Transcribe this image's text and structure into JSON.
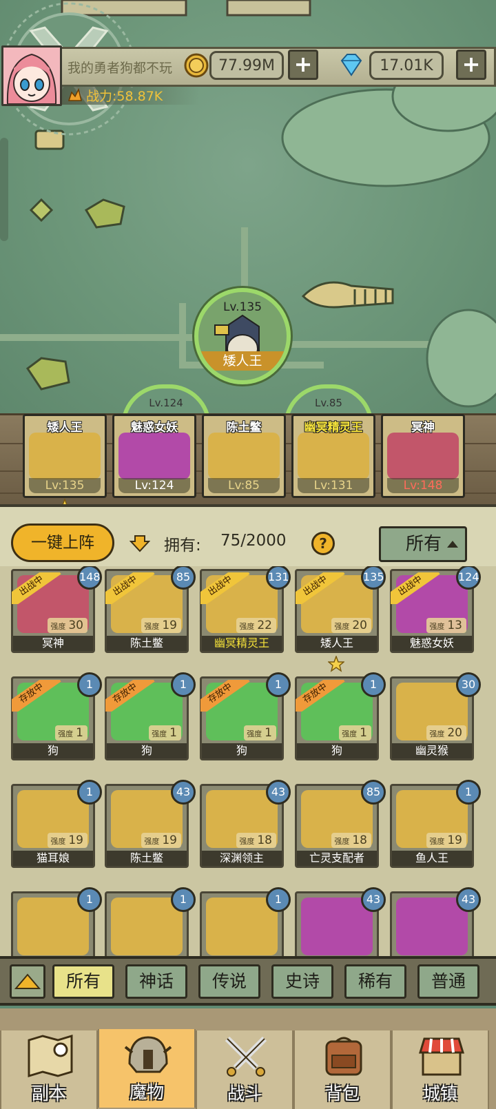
{
  "header": {
    "player_name": "我的勇者狗都不玩",
    "gold": "77.99M",
    "gems": "17.01K",
    "power_label": "战力:58.87K",
    "plus_label": "+"
  },
  "selected": {
    "level": "Lv.135",
    "name": "矮人王"
  },
  "ghost_levels": [
    "Lv.124",
    "Lv.85"
  ],
  "team": [
    {
      "name": "矮人王",
      "level": "Lv:135",
      "color": "#d9b24a"
    },
    {
      "name": "魅惑女妖",
      "level": "Lv:124",
      "color": "#b24aa8"
    },
    {
      "name": "陈土鳖",
      "level": "Lv:85",
      "color": "#d9b24a"
    },
    {
      "name": "幽冥精灵王",
      "level": "Lv:131",
      "color": "#d9b24a"
    },
    {
      "name": "冥神",
      "level": "Lv:148",
      "color": "#c2566a"
    }
  ],
  "inventory": {
    "one_click_label": "一键上阵",
    "own_label": "拥有:",
    "own_count": "75/2000",
    "help": "?",
    "sort_label": "所有",
    "strength_prefix": "强度",
    "ribbons": {
      "battle": "出战中",
      "stored": "存放中"
    },
    "monsters": [
      {
        "name": "冥神",
        "level": "148",
        "strength": "30",
        "bg": "#c2566a",
        "ribbon": "battle"
      },
      {
        "name": "陈土鳖",
        "level": "85",
        "strength": "19",
        "bg": "#d9b24a",
        "ribbon": "battle"
      },
      {
        "name": "幽冥精灵王",
        "level": "131",
        "strength": "22",
        "bg": "#d9b24a",
        "ribbon": "battle"
      },
      {
        "name": "矮人王",
        "level": "135",
        "strength": "20",
        "bg": "#d9b24a",
        "ribbon": "battle"
      },
      {
        "name": "魅惑女妖",
        "level": "124",
        "strength": "13",
        "bg": "#b24aa8",
        "ribbon": "battle"
      },
      {
        "name": "狗",
        "level": "1",
        "strength": "1",
        "bg": "#5fbf5a",
        "ribbon": "stored"
      },
      {
        "name": "狗",
        "level": "1",
        "strength": "1",
        "bg": "#5fbf5a",
        "ribbon": "stored"
      },
      {
        "name": "狗",
        "level": "1",
        "strength": "1",
        "bg": "#5fbf5a",
        "ribbon": "stored"
      },
      {
        "name": "狗",
        "level": "1",
        "strength": "1",
        "bg": "#5fbf5a",
        "ribbon": "stored"
      },
      {
        "name": "幽灵猴",
        "level": "30",
        "strength": "20",
        "bg": "#d9b24a",
        "ribbon": ""
      },
      {
        "name": "猫耳娘",
        "level": "1",
        "strength": "19",
        "bg": "#d9b24a",
        "ribbon": ""
      },
      {
        "name": "陈土鳖",
        "level": "43",
        "strength": "19",
        "bg": "#d9b24a",
        "ribbon": ""
      },
      {
        "name": "深渊领主",
        "level": "43",
        "strength": "18",
        "bg": "#d9b24a",
        "ribbon": ""
      },
      {
        "name": "亡灵支配者",
        "level": "85",
        "strength": "18",
        "bg": "#d9b24a",
        "ribbon": ""
      },
      {
        "name": "鱼人王",
        "level": "1",
        "strength": "19",
        "bg": "#d9b24a",
        "ribbon": ""
      },
      {
        "name": "",
        "level": "1",
        "strength": "",
        "bg": "#d9b24a",
        "ribbon": ""
      },
      {
        "name": "",
        "level": "1",
        "strength": "",
        "bg": "#d9b24a",
        "ribbon": ""
      },
      {
        "name": "",
        "level": "1",
        "strength": "",
        "bg": "#d9b24a",
        "ribbon": ""
      },
      {
        "name": "",
        "level": "43",
        "strength": "",
        "bg": "#b24aa8",
        "ribbon": ""
      },
      {
        "name": "",
        "level": "43",
        "strength": "",
        "bg": "#b24aa8",
        "ribbon": ""
      }
    ]
  },
  "filters": [
    "所有",
    "神话",
    "传说",
    "史诗",
    "稀有",
    "普通"
  ],
  "nav": [
    {
      "label": "副本",
      "icon": "map-icon"
    },
    {
      "label": "魔物",
      "icon": "helmet-icon"
    },
    {
      "label": "战斗",
      "icon": "crossed-swords-icon"
    },
    {
      "label": "背包",
      "icon": "backpack-icon"
    },
    {
      "label": "城镇",
      "icon": "shop-icon"
    }
  ]
}
